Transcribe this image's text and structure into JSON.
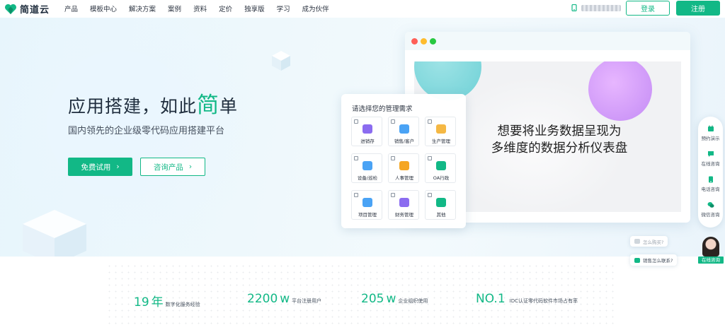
{
  "nav": {
    "logo_text": "简道云",
    "menu": [
      "产品",
      "模板中心",
      "解决方案",
      "案例",
      "资料",
      "定价",
      "独享版",
      "学习",
      "成为伙伴"
    ],
    "login": "登录",
    "register": "注册",
    "phone_icon": "phone-icon"
  },
  "hero": {
    "headline_pre": "应用搭建，如此",
    "headline_accent": "简",
    "headline_post": "单",
    "subline": "国内领先的企业级零代码应用搭建平台",
    "btn_trial": "免费试用",
    "btn_consult": "咨询产品",
    "chevron": "›"
  },
  "browser": {
    "dots": [
      "#ff5f57",
      "#febc2e",
      "#28c840"
    ],
    "line1": "想要将业务数据呈现为",
    "line2": "多维度的数据分析仪表盘"
  },
  "panel": {
    "title": "请选择您的管理需求",
    "tiles": [
      {
        "label": "进销存",
        "color": "#8b6cf0"
      },
      {
        "label": "销售/客户",
        "color": "#4aa3f5"
      },
      {
        "label": "生产管理",
        "color": "#f5b844"
      },
      {
        "label": "设备/巡检",
        "color": "#4aa3f5"
      },
      {
        "label": "人事管理",
        "color": "#f5a623"
      },
      {
        "label": "OA行政",
        "color": "#12b886"
      },
      {
        "label": "项目管理",
        "color": "#4aa3f5"
      },
      {
        "label": "财务管理",
        "color": "#8b6cf0"
      },
      {
        "label": "其他",
        "color": "#12b886"
      }
    ]
  },
  "floatbar": {
    "items": [
      {
        "label": "预约演示",
        "icon": "calendar-icon"
      },
      {
        "label": "在线咨询",
        "icon": "chat-icon"
      },
      {
        "label": "电话咨询",
        "icon": "phone-icon"
      },
      {
        "label": "微信咨询",
        "icon": "wechat-icon"
      }
    ],
    "bubble1": "怎么购买?",
    "bubble2": "销售怎么联系?",
    "avatar_label": "在线咨询"
  },
  "stats": [
    {
      "num": "19",
      "unit": "年",
      "desc": "数字化服务经验"
    },
    {
      "num": "2200",
      "unit": "w",
      "desc": "平台注册用户"
    },
    {
      "num": "205",
      "unit": "w",
      "desc": "企业组织使用"
    },
    {
      "num": "NO.1",
      "unit": "",
      "desc": "IDC认证零代码软件市场占有率"
    }
  ],
  "colors": {
    "brand": "#12b886"
  }
}
